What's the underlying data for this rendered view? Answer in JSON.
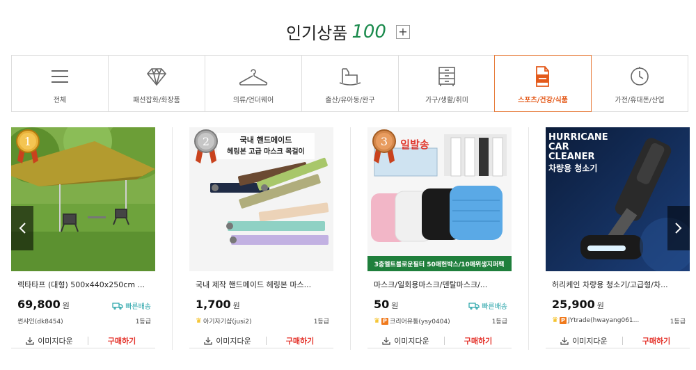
{
  "heading": {
    "title": "인기상품",
    "count": "100",
    "plus": "+"
  },
  "categories": [
    {
      "label": "전체",
      "icon": "menu-icon"
    },
    {
      "label": "패션잡화/화장품",
      "icon": "diamond-icon"
    },
    {
      "label": "의류/언더웨어",
      "icon": "hanger-icon"
    },
    {
      "label": "출산/유아동/완구",
      "icon": "rocking-horse-icon"
    },
    {
      "label": "가구/생활/취미",
      "icon": "cabinet-icon"
    },
    {
      "label": "스포츠/건강/식품",
      "icon": "food-box-icon",
      "active": true
    },
    {
      "label": "가전/휴대폰/산업",
      "icon": "clock-icon"
    }
  ],
  "products": [
    {
      "rank": "1",
      "name": "렉타타프 (대형) 500x440x250cm ...",
      "price": "69,800",
      "currency": "원",
      "fast_shipping": "빠른배송",
      "seller": "썬샤인(dk8454)",
      "grade": "1등급",
      "download": "이미지다운",
      "buy": "구매하기"
    },
    {
      "rank": "2",
      "name": "국내 제작 핸드메이드 헤링본 마스...",
      "price": "1,700",
      "currency": "원",
      "seller": "아기자기샵(jusi2)",
      "grade": "1등급",
      "download": "이미지다운",
      "buy": "구매하기",
      "image_text": [
        "국내 핸드메이드",
        "헤링본 고급 마스크 목걸이"
      ]
    },
    {
      "rank": "3",
      "name": "마스크/일회용마스크/덴탈마스크/...",
      "price": "50",
      "currency": "원",
      "fast_shipping": "빠른배송",
      "seller": "크리어유통(ysy0404)",
      "grade": "1등급",
      "download": "이미지다운",
      "buy": "구매하기",
      "image_text": [
        "일발송",
        "3중멜트블로운필터 50매헌박스/10매위생지퍼팩"
      ]
    },
    {
      "rank": "",
      "name": "허리케인 차량용 청소기/고급형/차...",
      "price": "25,900",
      "currency": "원",
      "seller": "JYtrade(hwayang061...",
      "grade": "1등급",
      "download": "이미지다운",
      "buy": "구매하기",
      "image_text": [
        "HURRICANE",
        "CAR",
        "CLEANER",
        "차량용 청소기"
      ]
    }
  ]
}
